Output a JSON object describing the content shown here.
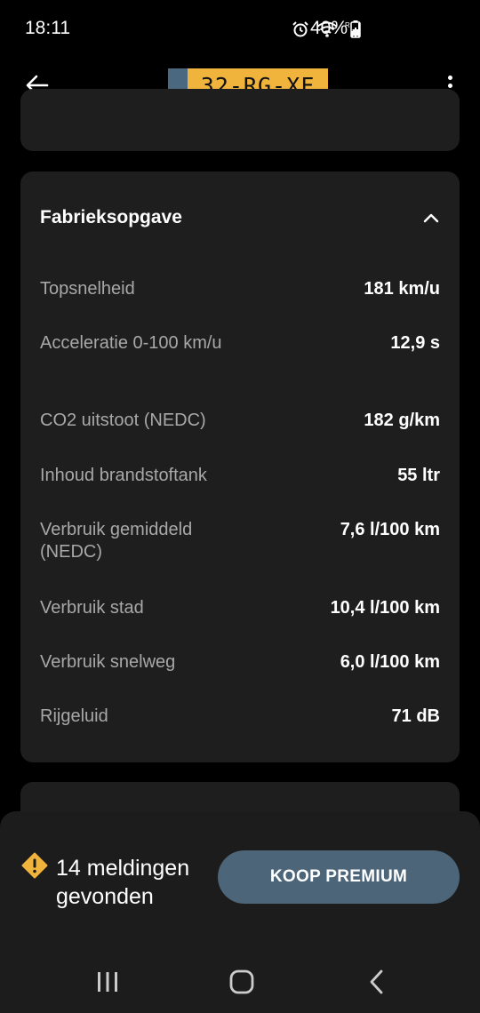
{
  "status_bar": {
    "time": "18:11",
    "battery_percent": "40%"
  },
  "app_bar": {
    "plate": "32-RG-XF",
    "plate_color": "#f0b43c",
    "plate_band_color": "#4a6880"
  },
  "card": {
    "title": "Fabrieksopgave",
    "specs": [
      {
        "label": "Topsnelheid",
        "value": "181 km/u"
      },
      {
        "label": "Acceleratie 0-100 km/u",
        "value": "12,9 s"
      },
      {
        "label": "CO2 uitstoot (NEDC)",
        "value": "182 g/km"
      },
      {
        "label": "Inhoud brandstoftank",
        "value": "55 ltr"
      },
      {
        "label": "Verbruik gemiddeld (NEDC)",
        "value": "7,6 l/100 km"
      },
      {
        "label": "Verbruik stad",
        "value": "10,4 l/100 km"
      },
      {
        "label": "Verbruik snelweg",
        "value": "6,0 l/100 km"
      },
      {
        "label": "Rijgeluid",
        "value": "71 dB"
      }
    ]
  },
  "bottom_sheet": {
    "warning": "14 meldingen gevonden",
    "warning_color": "#f0b43c",
    "premium_button": "KOOP PREMIUM",
    "premium_color": "#4c6579"
  },
  "icons": {
    "back": "arrow-left-icon",
    "menu": "more-vertical-icon",
    "collapse": "chevron-up-icon",
    "warning": "warning-diamond-icon",
    "nav_recents": "recents-icon",
    "nav_home": "home-icon",
    "nav_back": "chevron-left-icon"
  }
}
